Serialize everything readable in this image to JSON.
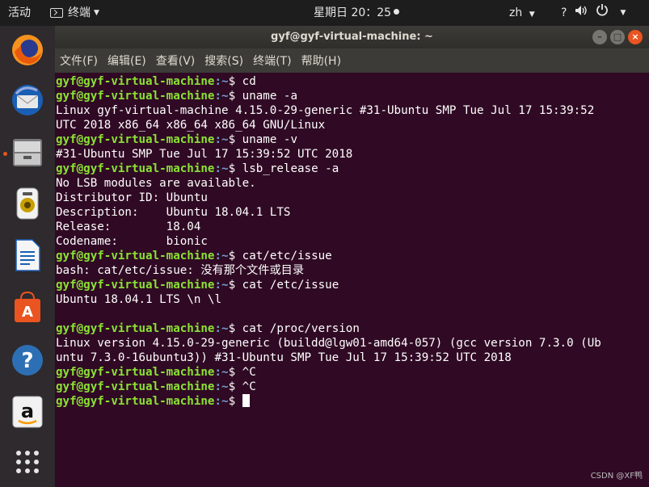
{
  "topbar": {
    "activities": "活动",
    "app_name": "终端",
    "clock": "星期日 20：25",
    "lang": "zh",
    "tray_icons": [
      "accessibility-icon",
      "volume-icon",
      "power-icon"
    ]
  },
  "dock": {
    "apps": [
      "firefox-icon",
      "thunderbird-icon",
      "files-icon",
      "rhythmbox-icon",
      "writer-icon",
      "software-center-icon",
      "help-icon",
      "amazon-icon",
      "show-apps-icon"
    ]
  },
  "window": {
    "title": "gyf@gyf-virtual-machine: ~",
    "menu": [
      "文件(F)",
      "编辑(E)",
      "查看(V)",
      "搜索(S)",
      "终端(T)",
      "帮助(H)"
    ]
  },
  "terminal": {
    "prompt_user": "gyf@gyf-virtual-machine",
    "prompt_path": ":~",
    "prompt_end": "$ ",
    "lines": [
      {
        "type": "cmd",
        "text": "cd"
      },
      {
        "type": "cmd",
        "text": "uname -a"
      },
      {
        "type": "out",
        "text": "Linux gyf-virtual-machine 4.15.0-29-generic #31-Ubuntu SMP Tue Jul 17 15:39:52"
      },
      {
        "type": "out",
        "text": "UTC 2018 x86_64 x86_64 x86_64 GNU/Linux"
      },
      {
        "type": "cmd",
        "text": "uname -v"
      },
      {
        "type": "out",
        "text": "#31-Ubuntu SMP Tue Jul 17 15:39:52 UTC 2018"
      },
      {
        "type": "cmd",
        "text": "lsb_release -a"
      },
      {
        "type": "out",
        "text": "No LSB modules are available."
      },
      {
        "type": "out",
        "text": "Distributor ID:\tUbuntu"
      },
      {
        "type": "out",
        "text": "Description:\tUbuntu 18.04.1 LTS"
      },
      {
        "type": "out",
        "text": "Release:\t18.04"
      },
      {
        "type": "out",
        "text": "Codename:\tbionic"
      },
      {
        "type": "cmd",
        "text": "cat/etc/issue"
      },
      {
        "type": "out",
        "text": "bash: cat/etc/issue: 没有那个文件或目录"
      },
      {
        "type": "cmd",
        "text": "cat /etc/issue"
      },
      {
        "type": "out",
        "text": "Ubuntu 18.04.1 LTS \\n \\l"
      },
      {
        "type": "out",
        "text": ""
      },
      {
        "type": "cmd",
        "text": "cat /proc/version"
      },
      {
        "type": "out",
        "text": "Linux version 4.15.0-29-generic (buildd@lgw01-amd64-057) (gcc version 7.3.0 (Ub"
      },
      {
        "type": "out",
        "text": "untu 7.3.0-16ubuntu3)) #31-Ubuntu SMP Tue Jul 17 15:39:52 UTC 2018"
      },
      {
        "type": "cmd",
        "text": "^C"
      },
      {
        "type": "cmd",
        "text": "^C"
      },
      {
        "type": "cmd",
        "text": ""
      }
    ]
  },
  "watermark": "CSDN @XF鸭"
}
